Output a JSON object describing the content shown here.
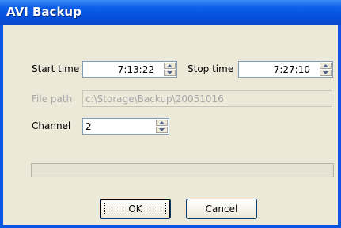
{
  "window": {
    "title": "AVI Backup"
  },
  "form": {
    "start_time_label": "Start time",
    "start_time_value": "7:13:22",
    "stop_time_label": "Stop time",
    "stop_time_value": "7:27:10",
    "file_path_label": "File path",
    "file_path_value": "c:\\Storage\\Backup\\20051016",
    "channel_label": "Channel",
    "channel_value": "2"
  },
  "progress": {
    "value": 0
  },
  "buttons": {
    "ok_label": "OK",
    "cancel_label": "Cancel"
  }
}
